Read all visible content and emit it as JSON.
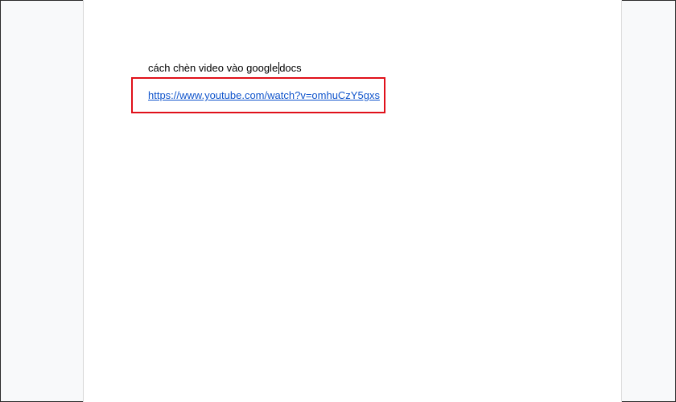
{
  "document": {
    "line_before_caret": "cách chèn video vào google",
    "line_after_caret": "docs",
    "link_text": "https://www.youtube.com/watch?v=omhuCzY5gxs"
  },
  "annotation": {
    "highlight_color": "#e0101a"
  },
  "colors": {
    "link": "#1155cc",
    "canvas": "#f8f9fa",
    "page": "#ffffff"
  }
}
